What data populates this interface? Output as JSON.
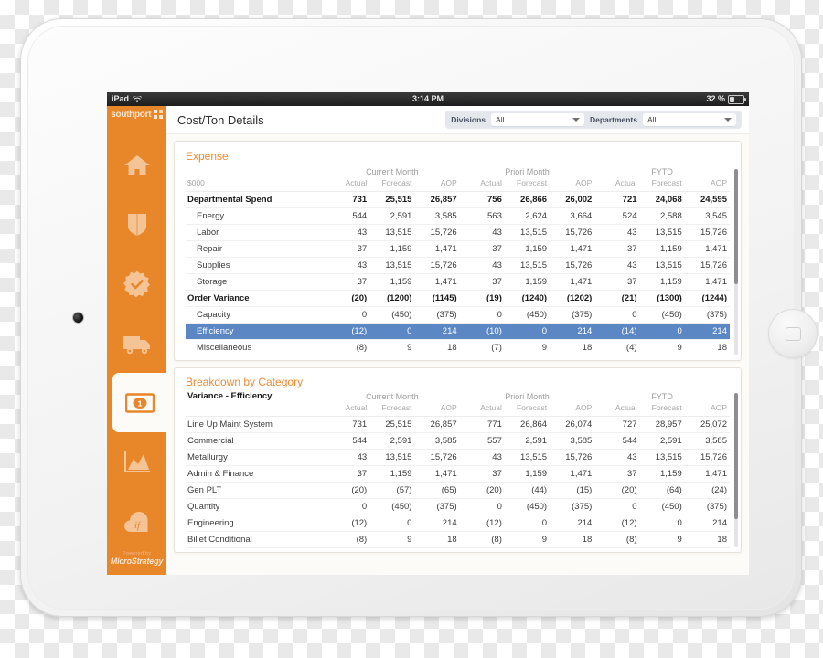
{
  "status_bar": {
    "device": "iPad",
    "wifi_icon": "wifi-icon",
    "time": "3:14 PM",
    "battery_percent": "32 %"
  },
  "sidebar": {
    "logo_text": "southport",
    "items": [
      {
        "icon": "home-icon",
        "name": "home"
      },
      {
        "icon": "shield-icon",
        "name": "shield"
      },
      {
        "icon": "badge-check-icon",
        "name": "quality"
      },
      {
        "icon": "truck-icon",
        "name": "logistics"
      },
      {
        "icon": "money-icon",
        "name": "cost",
        "active": true
      },
      {
        "icon": "area-chart-icon",
        "name": "analytics"
      },
      {
        "icon": "if-cloud-icon",
        "name": "scenarios"
      }
    ],
    "powered_by_small": "Powered by",
    "powered_by_brand": "MicroStrategy"
  },
  "header": {
    "title": "Cost/Ton Details",
    "filters": [
      {
        "label": "Divisions",
        "value": "All",
        "caret_icon": "chevron-down-icon"
      },
      {
        "label": "Departments",
        "value": "All",
        "caret_icon": "chevron-down-icon"
      }
    ]
  },
  "expense_panel": {
    "title": "Expense",
    "unit_label": "$000",
    "groups": [
      "Current Month",
      "Priori Month",
      "FYTD"
    ],
    "metrics": [
      "Actual",
      "Forecast",
      "AOP"
    ],
    "rows": [
      {
        "label": "Departmental Spend",
        "bold": true,
        "values": [
          "731",
          "25,515",
          "26,857",
          "756",
          "26,866",
          "26,002",
          "721",
          "24,068",
          "24,595"
        ]
      },
      {
        "label": "Energy",
        "child": true,
        "values": [
          "544",
          "2,591",
          "3,585",
          "563",
          "2,624",
          "3,664",
          "524",
          "2,588",
          "3,545"
        ]
      },
      {
        "label": "Labor",
        "child": true,
        "values": [
          "43",
          "13,515",
          "15,726",
          "43",
          "13,515",
          "15,726",
          "43",
          "13,515",
          "15,726"
        ]
      },
      {
        "label": "Repair",
        "child": true,
        "values": [
          "37",
          "1,159",
          "1,471",
          "37",
          "1,159",
          "1,471",
          "37",
          "1,159",
          "1,471"
        ]
      },
      {
        "label": "Supplies",
        "child": true,
        "values": [
          "43",
          "13,515",
          "15,726",
          "43",
          "13,515",
          "15,726",
          "43",
          "13,515",
          "15,726"
        ]
      },
      {
        "label": "Storage",
        "child": true,
        "values": [
          "37",
          "1,159",
          "1,471",
          "37",
          "1,159",
          "1,471",
          "37",
          "1,159",
          "1,471"
        ]
      },
      {
        "label": "Order Variance",
        "bold": true,
        "values": [
          "(20)",
          "(1200)",
          "(1145)",
          "(19)",
          "(1240)",
          "(1202)",
          "(21)",
          "(1300)",
          "(1244)"
        ]
      },
      {
        "label": "Capacity",
        "child": true,
        "values": [
          "0",
          "(450)",
          "(375)",
          "0",
          "(450)",
          "(375)",
          "0",
          "(450)",
          "(375)"
        ]
      },
      {
        "label": "Efficiency",
        "child": true,
        "selected": true,
        "values": [
          "(12)",
          "0",
          "214",
          "(10)",
          "0",
          "214",
          "(14)",
          "0",
          "214"
        ]
      },
      {
        "label": "Miscellaneous",
        "child": true,
        "values": [
          "(8)",
          "9",
          "18",
          "(7)",
          "9",
          "18",
          "(4)",
          "9",
          "18"
        ]
      }
    ]
  },
  "breakdown_panel": {
    "title": "Breakdown by Category",
    "variance_label": "Variance - Efficiency",
    "groups": [
      "Current Month",
      "Priori Month",
      "FYTD"
    ],
    "metrics": [
      "Actual",
      "Forecast",
      "AOP"
    ],
    "rows": [
      {
        "label": "Line Up Maint System",
        "values": [
          "731",
          "25,515",
          "26,857",
          "771",
          "26,864",
          "26,074",
          "727",
          "28,957",
          "25,072"
        ]
      },
      {
        "label": "Commercial",
        "values": [
          "544",
          "2,591",
          "3,585",
          "557",
          "2,591",
          "3,585",
          "544",
          "2,591",
          "3,585"
        ]
      },
      {
        "label": "Metallurgy",
        "values": [
          "43",
          "13,515",
          "15,726",
          "43",
          "13,515",
          "15,726",
          "43",
          "13,515",
          "15,726"
        ]
      },
      {
        "label": "Admin & Finance",
        "values": [
          "37",
          "1,159",
          "1,471",
          "37",
          "1,159",
          "1,471",
          "37",
          "1,159",
          "1,471"
        ]
      },
      {
        "label": "Gen PLT",
        "values": [
          "(20)",
          "(57)",
          "(65)",
          "(20)",
          "(44)",
          "(15)",
          "(20)",
          "(64)",
          "(24)"
        ]
      },
      {
        "label": "Quantity",
        "values": [
          "0",
          "(450)",
          "(375)",
          "0",
          "(450)",
          "(375)",
          "0",
          "(450)",
          "(375)"
        ]
      },
      {
        "label": "Engineering",
        "values": [
          "(12)",
          "0",
          "214",
          "(12)",
          "0",
          "214",
          "(12)",
          "0",
          "214"
        ]
      },
      {
        "label": "Billet Conditional",
        "values": [
          "(8)",
          "9",
          "18",
          "(8)",
          "9",
          "18",
          "(8)",
          "9",
          "18"
        ]
      }
    ]
  },
  "colors": {
    "brand_orange": "#e8862a",
    "title_orange": "#ef8b35",
    "selection_blue": "#5b87c5",
    "panel_bg": "#fdfbf7"
  }
}
